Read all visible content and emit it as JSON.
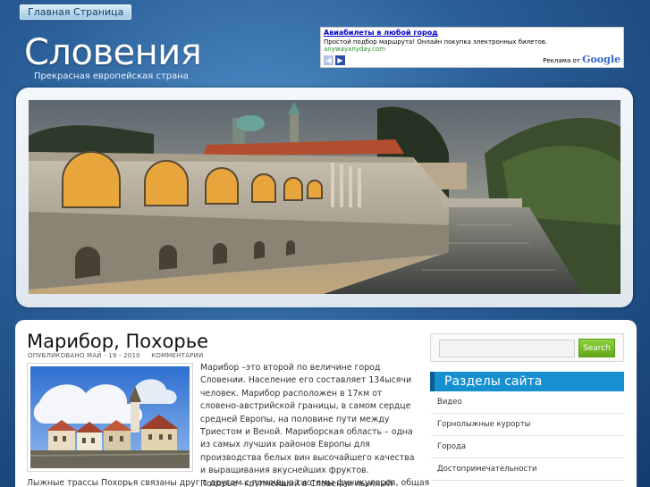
{
  "nav": {
    "home": "Главная Страница"
  },
  "site": {
    "title": "Словения",
    "tagline": "Прекрасная европейская страна"
  },
  "ad": {
    "headline": "Авиабилеты в любой город",
    "description": "Простой подбор маршрута! Онлайн покупка электронных билетов.",
    "url": "anywayanyday.com",
    "brand_prefix": "Реклама от",
    "brand_name": "Google"
  },
  "post": {
    "title": "Марибор, Похорье",
    "date": "ОПУБЛИКОВАНО МАЙ - 19 - 2010",
    "comments": "КОММЕНТАРИИ",
    "paragraph1": "Марибор  –это второй по величине город Словении. Население его составляет    134ысячи человек. Марибор расположен в 17км от словено-австрийской границы, в самом сердце средней Европы, на половине пути между Триестом и Веной. Мариборская область – одна из самых лучших районов Европы для производства белых вин высочайшего качества и выращивания вкуснейших фруктов.",
    "paragraph2_start": "Похорье  –крупнейший в Словении лыжный центр.",
    "paragraph2_cont": "Лыжные трассы Похорья связаны друг с другом с помощью системы фуникулеров, общая"
  },
  "search": {
    "placeholder": "",
    "button": "Search"
  },
  "sidebar": {
    "title": "Разделы сайта",
    "items": [
      {
        "label": "Видео"
      },
      {
        "label": "Горнолыжные курорты"
      },
      {
        "label": "Города"
      },
      {
        "label": "Достопримечательности"
      }
    ]
  }
}
